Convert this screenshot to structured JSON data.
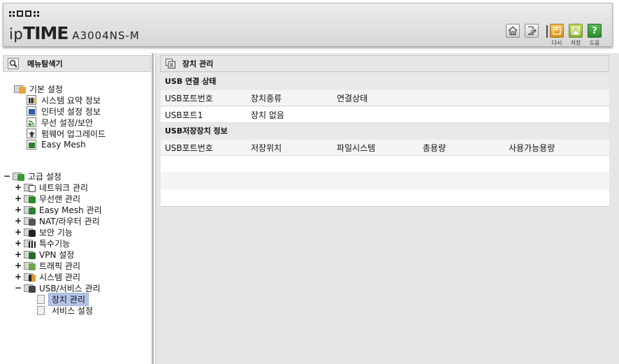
{
  "header": {
    "brand_ip": "ip",
    "brand_time": "TIME",
    "model": "A3004NS-M",
    "buttons": {
      "home_icon": "home-icon",
      "logout_icon": "logout-icon",
      "refresh_label": "다시",
      "save_label": "저장",
      "help_label": "도움",
      "help_glyph": "?"
    }
  },
  "sidebar": {
    "title": "메뉴탐색기",
    "basic": {
      "label": "기본 설정",
      "items": [
        {
          "label": "시스템 요약 정보",
          "icon": "chart-icon"
        },
        {
          "label": "인터넷 설정 정보",
          "icon": "monitor-icon"
        },
        {
          "label": "무선 설정/보안",
          "icon": "wireless-icon"
        },
        {
          "label": "펌웨어 업그레이드",
          "icon": "upgrade-icon"
        },
        {
          "label": "Easy Mesh",
          "icon": "mesh-icon"
        }
      ]
    },
    "advanced": {
      "toggle": "−",
      "label": "고급 설정",
      "items": [
        {
          "toggle": "+",
          "label": "네트워크 관리",
          "icon": "network-icon"
        },
        {
          "toggle": "+",
          "label": "무선랜 관리",
          "icon": "wireless-icon"
        },
        {
          "toggle": "+",
          "label": "Easy Mesh 관리",
          "icon": "mesh-icon"
        },
        {
          "toggle": "+",
          "label": "NAT/라우터 관리",
          "icon": "router-icon"
        },
        {
          "toggle": "+",
          "label": "보안 기능",
          "icon": "lock-icon"
        },
        {
          "toggle": "+",
          "label": "특수기능",
          "icon": "special-icon"
        },
        {
          "toggle": "+",
          "label": "VPN 설정",
          "icon": "vpn-icon"
        },
        {
          "toggle": "+",
          "label": "트래픽 관리",
          "icon": "traffic-icon"
        },
        {
          "toggle": "+",
          "label": "시스템 관리",
          "icon": "chart-icon"
        },
        {
          "toggle": "−",
          "label": "USB/서비스 관리",
          "icon": "usb-icon"
        }
      ],
      "usb_children": [
        {
          "label": "장치 관리",
          "selected": true
        },
        {
          "label": "서비스 설정",
          "selected": false
        }
      ]
    }
  },
  "main": {
    "title": "장치 관리",
    "usb_connection": {
      "title": "USB 연결 상태",
      "columns": [
        "USB포트번호",
        "장치종류",
        "연결상태"
      ],
      "rows": [
        [
          "USB포트1",
          "장치 없음",
          ""
        ]
      ]
    },
    "usb_storage": {
      "title": "USB저장장치 정보",
      "columns": [
        "USB포트번호",
        "저장위치",
        "파일시스템",
        "총용량",
        "사용가능용량"
      ],
      "rows": []
    }
  }
}
